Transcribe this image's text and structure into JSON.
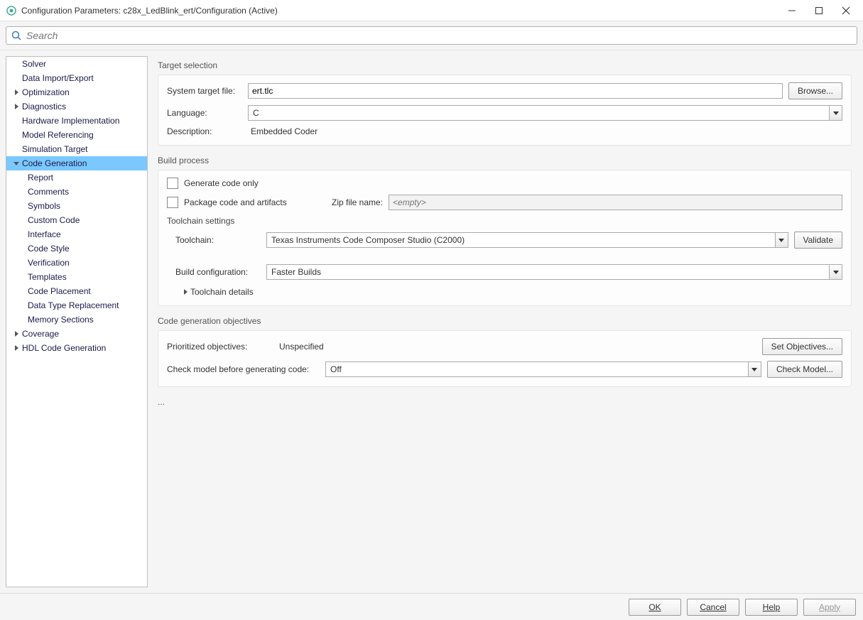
{
  "window": {
    "title": "Configuration Parameters: c28x_LedBlink_ert/Configuration (Active)"
  },
  "search": {
    "placeholder": "Search"
  },
  "tree": {
    "items": [
      {
        "label": "Solver",
        "level": 0,
        "arrow": ""
      },
      {
        "label": "Data Import/Export",
        "level": 0,
        "arrow": ""
      },
      {
        "label": "Optimization",
        "level": 0,
        "arrow": "right"
      },
      {
        "label": "Diagnostics",
        "level": 0,
        "arrow": "right"
      },
      {
        "label": "Hardware Implementation",
        "level": 0,
        "arrow": ""
      },
      {
        "label": "Model Referencing",
        "level": 0,
        "arrow": ""
      },
      {
        "label": "Simulation Target",
        "level": 0,
        "arrow": ""
      },
      {
        "label": "Code Generation",
        "level": 0,
        "arrow": "down",
        "selected": true
      },
      {
        "label": "Report",
        "level": 1,
        "arrow": ""
      },
      {
        "label": "Comments",
        "level": 1,
        "arrow": ""
      },
      {
        "label": "Symbols",
        "level": 1,
        "arrow": ""
      },
      {
        "label": "Custom Code",
        "level": 1,
        "arrow": ""
      },
      {
        "label": "Interface",
        "level": 1,
        "arrow": ""
      },
      {
        "label": "Code Style",
        "level": 1,
        "arrow": ""
      },
      {
        "label": "Verification",
        "level": 1,
        "arrow": ""
      },
      {
        "label": "Templates",
        "level": 1,
        "arrow": ""
      },
      {
        "label": "Code Placement",
        "level": 1,
        "arrow": ""
      },
      {
        "label": "Data Type Replacement",
        "level": 1,
        "arrow": ""
      },
      {
        "label": "Memory Sections",
        "level": 1,
        "arrow": ""
      },
      {
        "label": "Coverage",
        "level": 0,
        "arrow": "right"
      },
      {
        "label": "HDL Code Generation",
        "level": 0,
        "arrow": "right"
      }
    ]
  },
  "target_selection": {
    "title": "Target selection",
    "stf_label": "System target file:",
    "stf_value": "ert.tlc",
    "browse": "Browse...",
    "lang_label": "Language:",
    "lang_value": "C",
    "desc_label": "Description:",
    "desc_value": "Embedded Coder"
  },
  "build_process": {
    "title": "Build process",
    "gen_only": "Generate code only",
    "package": "Package code and artifacts",
    "zip_label": "Zip file name:",
    "zip_placeholder": "<empty>",
    "toolchain_settings": "Toolchain settings",
    "toolchain_label": "Toolchain:",
    "toolchain_value": "Texas Instruments Code Composer Studio (C2000)",
    "validate": "Validate",
    "buildcfg_label": "Build configuration:",
    "buildcfg_value": "Faster Builds",
    "details": "Toolchain details"
  },
  "objectives": {
    "title": "Code generation objectives",
    "prio_label": "Prioritized objectives:",
    "prio_value": "Unspecified",
    "set_btn": "Set Objectives...",
    "check_label": "Check model before generating code:",
    "check_value": "Off",
    "check_btn": "Check Model..."
  },
  "ellipsis": "...",
  "footer": {
    "ok": "OK",
    "cancel": "Cancel",
    "help": "Help",
    "apply": "Apply"
  }
}
